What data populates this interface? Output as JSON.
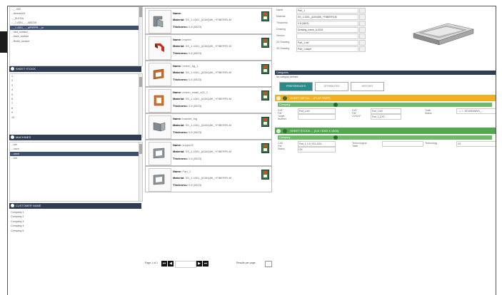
{
  "left_list_top": [
    "..._..000",
    "...ilenme001",
    "..._ELEGA",
    "..._1.4301_..._ABCDE",
    "..._1.4301_..._#PRFPR..._m",
    "...ract_contact_.",
    "...back_contact",
    "...ftinitd_contact"
  ],
  "left_list_top_selected_index": 4,
  "section_sheet_stock": "SHEET STOCK",
  "sheet_stock_items": [
    "1",
    "2",
    "3",
    "4",
    "5",
    "6",
    "7",
    "8",
    "9",
    "10"
  ],
  "section_machines": "MACHINES",
  "machines_items": [
    "...ser",
    "...unch",
    "...unch",
    "...ser"
  ],
  "machines_selected_index": 2,
  "section_customer": "CUSTOMER NAME",
  "customer_items": [
    "Company 1",
    "Company 2",
    "Company 3",
    "Company 4",
    "Company 5"
  ],
  "cards": [
    {
      "name": "",
      "material": "SS_1.4301_(A304)8K_+FIBERFILM",
      "thickness": "0.8  (0823)",
      "icon": "gray-bracket-icon"
    },
    {
      "name": "Imprint",
      "material": "SS_1.4301_(A304)8K_+FIBERFILM",
      "thickness": "0.8  (0823)",
      "icon": "red-bent-part-icon"
    },
    {
      "name": "extern_bg_1",
      "material": "SS_1.4301_(A304)8K_+FIBERFILM",
      "thickness": "0.8  (0823)",
      "icon": "orange-frame-icon"
    },
    {
      "name": "extern_small_v02_1",
      "material": "SS_1.4301_(A304)8K_+FIBERFILM",
      "thickness": "0.8  (0823)",
      "icon": "orange-bracket-icon"
    },
    {
      "name": "bracket_lng",
      "material": "SS_1.4301_(A304)8K_+FIBERFILM",
      "thickness": "0.8  (0823)",
      "icon": "gray-long-bracket-icon"
    },
    {
      "name": "support1",
      "material": "SS_1.4301_(A304)8K_+FIBERFILM",
      "thickness": "0.8  (0823)",
      "icon": "gray-frame-icon"
    },
    {
      "name": "Part_1",
      "material": "SS_1.4301_(A304)8K_+FIBERFILM",
      "thickness": "0.8  (0823)",
      "icon": "gray-frame-icon"
    }
  ],
  "labels": {
    "name": "Name:",
    "material": "Material:",
    "thickness": "Thickness:"
  },
  "pager": {
    "text": "Page 1 of 1",
    "per_page": "Results per page:",
    "per_page_value": ""
  },
  "details": [
    {
      "label": "Name",
      "value": "Part_1"
    },
    {
      "label": "Material",
      "value": "SS_1.4301_(A304)8K_+FIBERFILM"
    },
    {
      "label": "Thickness",
      "value": "0.8  (0823)"
    },
    {
      "label": "Drawing",
      "value": "Drawing_name_A-0001"
    },
    {
      "label": "Version",
      "value": ""
    },
    {
      "label": "2D Drawing",
      "value": "Part_1.dxf"
    },
    {
      "label": "3D Drawing",
      "value": "Part_1.sldprt"
    }
  ],
  "category_bar": "Categories",
  "category_text": "No category defined",
  "tabs": [
    "PREFERENCES",
    "ATTRIBUTES",
    "HISTORY"
  ],
  "tab_active_index": 0,
  "yellow_section": "SHEET METAL ... (FLAT PART)",
  "yellow_green_header": "Company",
  "fields_y": [
    {
      "label": "DXF File",
      "value": "Part_1.dxf"
    },
    {
      "label": "DXF File",
      "value": "Part_1.dxf"
    },
    {
      "label": "Tooth Status",
      "value": "...\\...\\...\\2D\\DRAWING_..."
    },
    {
      "label": "Target Number",
      "value": ""
    },
    {
      "label": "UV/DXF",
      "value": "Part_1_DXF..."
    }
  ],
  "green_section": "SHEET STOCK ... (0.8 / 3000 X 1500)",
  "green_green_header": "Company",
  "fields_g": [
    {
      "label": "CAD File",
      "value": "Part_1_0.8_SS1.4301..."
    },
    {
      "label": "Technological Table",
      "value": ""
    },
    {
      "label": "Technology",
      "value": "XS"
    },
    {
      "label": "Status",
      "value": "OK"
    }
  ],
  "colors": {
    "dark_navy": "#2e3d55",
    "teal": "#2b8a8a",
    "yellow": "#f1b021",
    "green": "#52a84e",
    "pdf_green": "#3a7a3a"
  }
}
